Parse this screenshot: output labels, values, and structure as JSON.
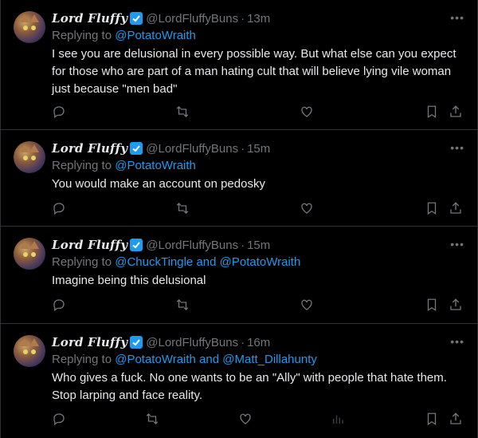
{
  "tweets": [
    {
      "name": "Lord Fluffy",
      "handle": "@LordFluffyBuns",
      "time": "13m",
      "replying_prefix": "Replying to",
      "mentions": [
        "@PotatoWraith"
      ],
      "text": "I see you are delusional in every possible way. But what else can you expect for those who are part of a man hating cult that will believe lying vile woman just because \"men bad\""
    },
    {
      "name": "Lord Fluffy",
      "handle": "@LordFluffyBuns",
      "time": "15m",
      "replying_prefix": "Replying to",
      "mentions": [
        "@PotatoWraith"
      ],
      "text": "You would make an account on pedosky"
    },
    {
      "name": "Lord Fluffy",
      "handle": "@LordFluffyBuns",
      "time": "15m",
      "replying_prefix": "Replying to",
      "mentions": [
        "@ChuckTingle",
        "@PotatoWraith"
      ],
      "and": "and",
      "text": "Imagine being this delusional"
    },
    {
      "name": "Lord Fluffy",
      "handle": "@LordFluffyBuns",
      "time": "16m",
      "replying_prefix": "Replying to",
      "mentions": [
        "@PotatoWraith",
        "@Matt_Dillahunty"
      ],
      "and": "and",
      "text": "Who gives a fuck. No one wants to be an \"Ally\" with people that hate them. Stop larping and face reality."
    }
  ],
  "icons": {
    "more": "more-horizontal-icon",
    "reply": "reply-icon",
    "retweet": "retweet-icon",
    "like": "like-icon",
    "views": "analytics-icon",
    "bookmark": "bookmark-icon",
    "share": "share-icon"
  },
  "colors": {
    "background": "#000000",
    "text": "#e7e9ea",
    "muted": "#71767b",
    "link": "#1d9bf0",
    "border": "#2f3336"
  }
}
